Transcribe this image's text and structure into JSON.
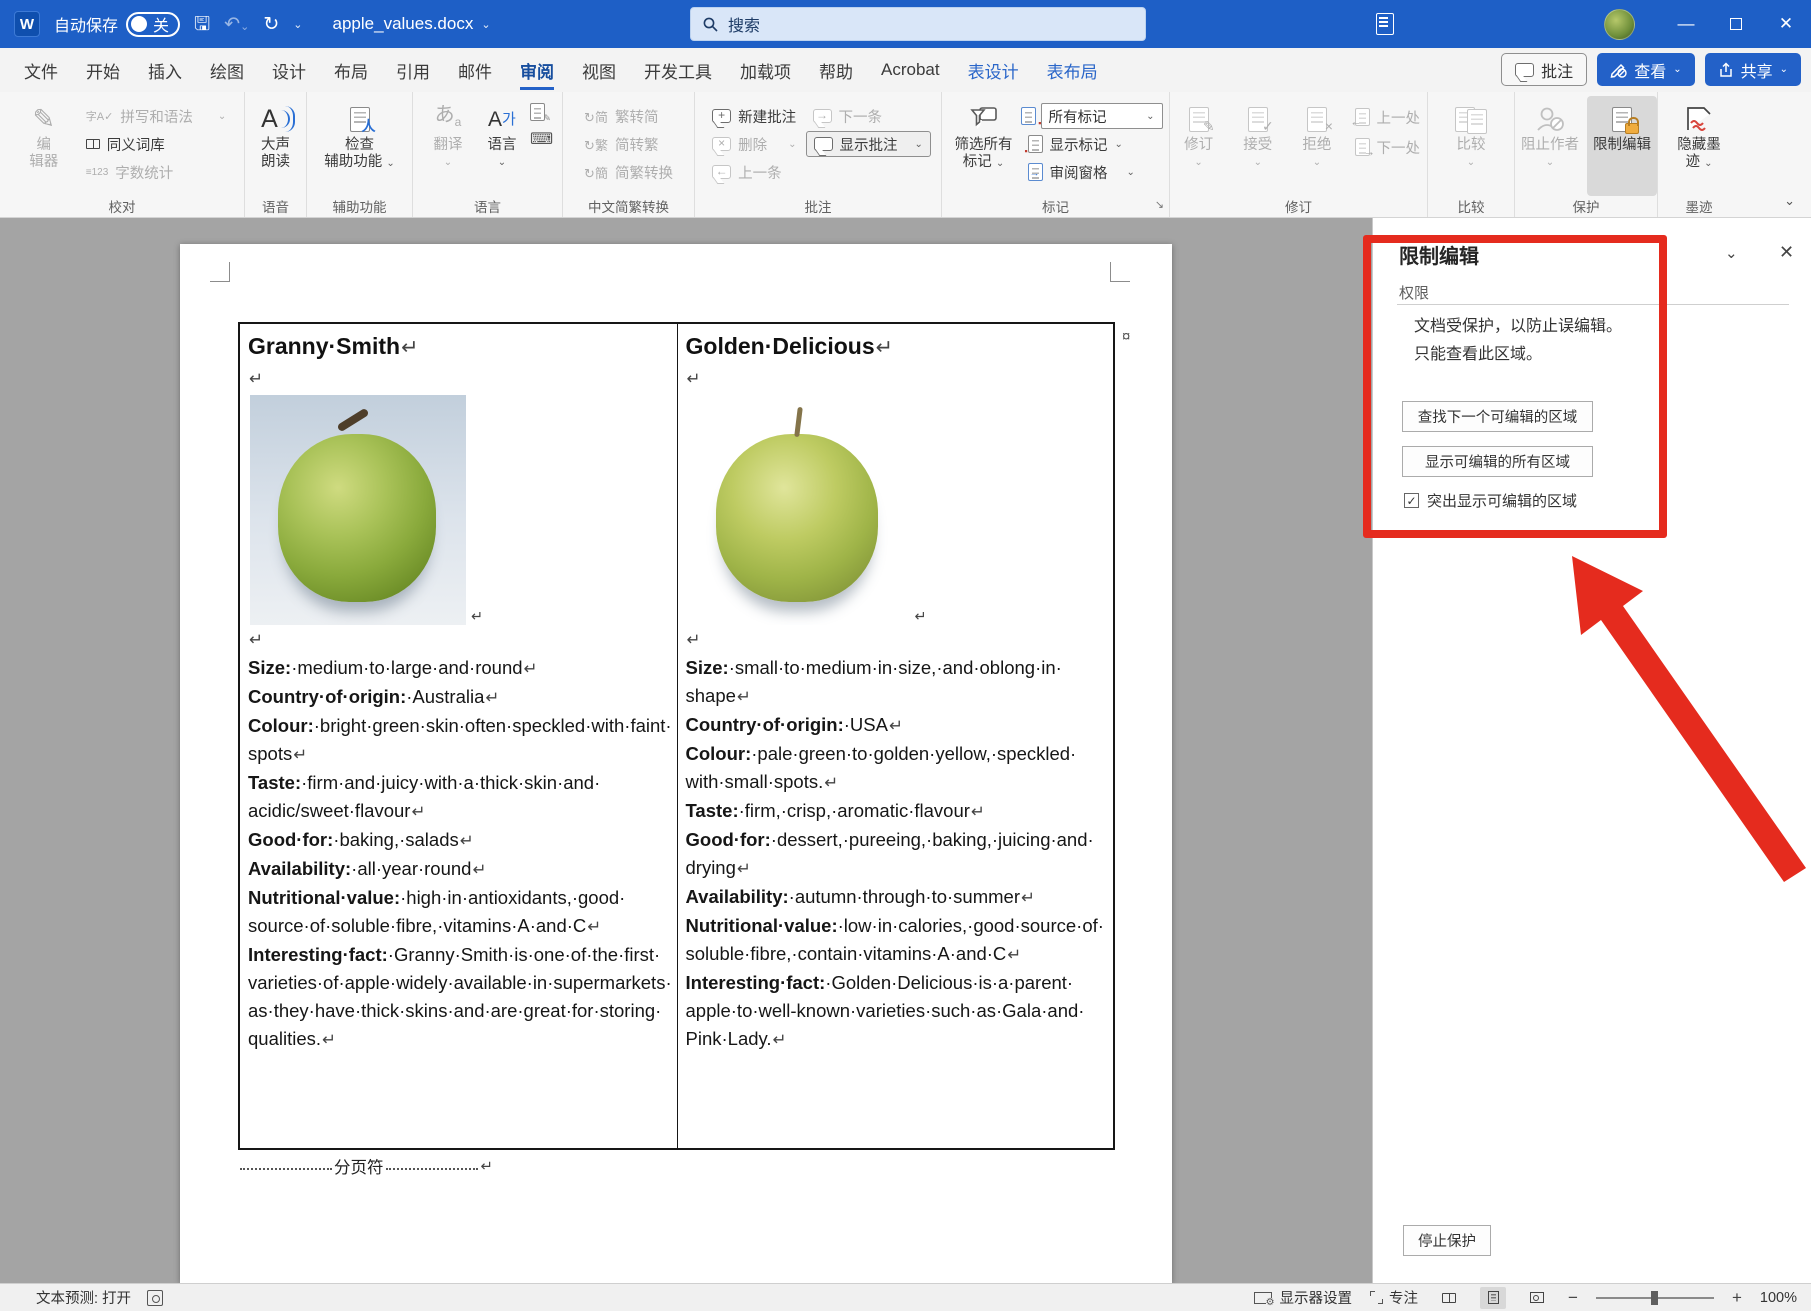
{
  "colors": {
    "titlebar": "#1e5fc6",
    "accent": "#2361c8",
    "red": "#e52b1e",
    "lock-orange": "#efac3f",
    "ink-red": "#d8453c",
    "canvas": "#a4a4a4",
    "blue-ic": "#2a6fd4"
  },
  "titlebar": {
    "autosave_label": "自动保存",
    "autosave_state": "关",
    "doc_title": "apple_values.docx",
    "search_placeholder": "搜索"
  },
  "tabs": {
    "file": "文件",
    "home": "开始",
    "insert": "插入",
    "draw": "绘图",
    "design": "设计",
    "layout": "布局",
    "references": "引用",
    "mailings": "邮件",
    "review": "审阅",
    "view": "视图",
    "devtools": "开发工具",
    "addins": "加载项",
    "help": "帮助",
    "acrobat": "Acrobat",
    "table_design": "表设计",
    "table_layout": "表布局",
    "comments_button": "批注",
    "view_button": "查看",
    "share_button": "共享"
  },
  "ribbon": {
    "proofing": {
      "label": "校对",
      "editor": [
        "编",
        "辑器"
      ],
      "spelling": "拼写和语法",
      "thesaurus": "同义词库",
      "wordcount": "字数统计"
    },
    "speech": {
      "label": "语音",
      "read_aloud": [
        "大声",
        "朗读"
      ]
    },
    "accessibility": {
      "label": "辅助功能",
      "check": [
        "检查",
        "辅助功能"
      ]
    },
    "language": {
      "label": "语言",
      "translate": "翻译",
      "language": "语言"
    },
    "chinese": {
      "label": "中文简繁转换",
      "t2s": "繁转简",
      "s2t": "简转繁",
      "convert": "简繁转换"
    },
    "comments": {
      "label": "批注",
      "new": "新建批注",
      "del": "删除",
      "prev": "上一条",
      "next": "下一条",
      "show": "显示批注"
    },
    "markup": {
      "label": "标记",
      "filter": [
        "筛选所有",
        "标记"
      ],
      "all_markup": "所有标记",
      "show_markup": "显示标记",
      "pane": "审阅窗格"
    },
    "tracking": {
      "label": "修订",
      "track": "修订",
      "accept": "接受",
      "reject": "拒绝",
      "prev": "上一处",
      "next": "下一处"
    },
    "compare": {
      "label": "比较",
      "compare": "比较"
    },
    "protect": {
      "label": "保护",
      "block": "阻止作者",
      "restrict": "限制编辑"
    },
    "ink": {
      "label": "墨迹",
      "hide": [
        "隐藏墨",
        "迹"
      ]
    }
  },
  "panel": {
    "title": "限制编辑",
    "section": "权限",
    "line1": "文档受保护，以防止误编辑。",
    "line2": "只能查看此区域。",
    "find_button": "查找下一个可编辑的区域",
    "show_button": "显示可编辑的所有区域",
    "highlight_checkbox": "突出显示可编辑的区域",
    "checkbox_state": "✓",
    "stop_button": "停止保护"
  },
  "document": {
    "pilcrow": "↵",
    "page_break_label": "分页符",
    "row_end_mark": "¤",
    "columns": [
      {
        "title": "Granny Smith",
        "paragraphs": [
          {
            "label": "Size:",
            "text": " medium to large and round"
          },
          {
            "label": "Country of origin:",
            "text": " Australia"
          },
          {
            "label": "Colour:",
            "text": " bright green skin often speckled with faint spots"
          },
          {
            "label": "Taste:",
            "text": " firm and juicy with a thick skin and acidic/sweet flavour"
          },
          {
            "label": "Good for:",
            "text": " baking, salads"
          },
          {
            "label": "Availability:",
            "text": " all year round"
          },
          {
            "label": "Nutritional value:",
            "text": " high in antioxidants, good source of soluble fibre, vitamins A and C"
          },
          {
            "label": "Interesting fact:",
            "text": " Granny Smith is one of the first varieties of apple widely available in supermarkets as they have thick skins and are great for storing qualities."
          }
        ]
      },
      {
        "title": "Golden Delicious",
        "paragraphs": [
          {
            "label": "Size:",
            "text": " small to medium in size, and oblong in shape"
          },
          {
            "label": "Country of origin:",
            "text": " USA"
          },
          {
            "label": "Colour:",
            "text": " pale green to golden yellow, speckled with small spots."
          },
          {
            "label": "Taste:",
            "text": " firm, crisp, aromatic flavour"
          },
          {
            "label": "Good for:",
            "text": " dessert, pureeing, baking, juicing and drying"
          },
          {
            "label": "Availability:",
            "text": " autumn through to summer"
          },
          {
            "label": "Nutritional value:",
            "text": " low in calories, good source of soluble fibre, contain vitamins A and C"
          },
          {
            "label": "Interesting fact:",
            "text": " Golden Delicious is a parent apple to well-known varieties such as Gala and Pink Lady."
          }
        ]
      }
    ]
  },
  "statusbar": {
    "text_prediction": "文本预测: 打开",
    "display_settings": "显示器设置",
    "focus": "专注",
    "zoom": "100%"
  }
}
